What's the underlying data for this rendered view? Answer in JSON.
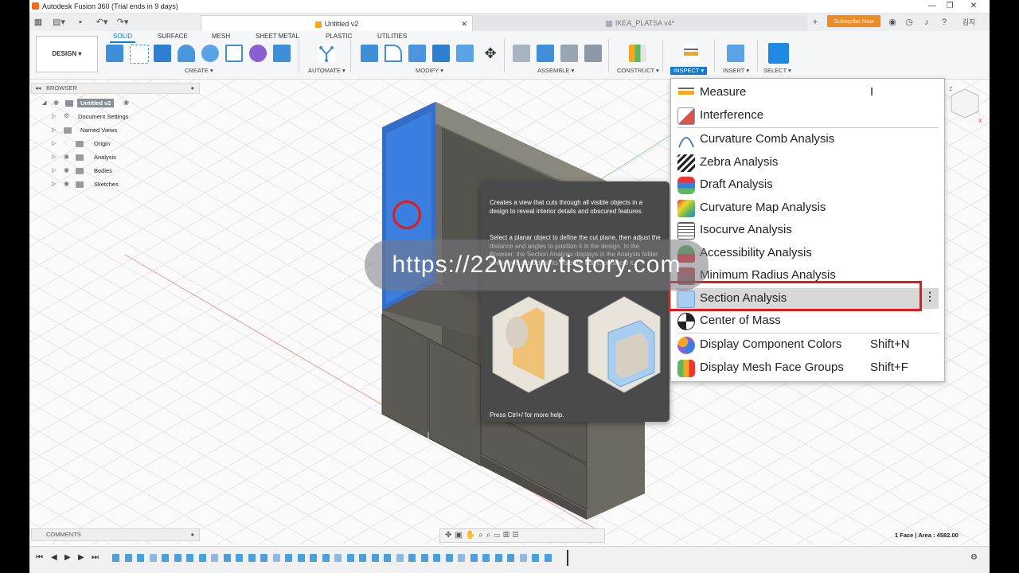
{
  "window": {
    "title": "Autodesk Fusion 360 (Trial ends in 9 days)"
  },
  "tabs": [
    {
      "label": "Untitled v2"
    },
    {
      "label": "IKEA_PLATSA v4*"
    }
  ],
  "header": {
    "subscribe_label": "Subscribe Now",
    "user_label": "김지"
  },
  "toolbar": {
    "workspace_label": "DESIGN ▾",
    "ws_tabs": [
      "SOLID",
      "SURFACE",
      "MESH",
      "SHEET METAL",
      "PLASTIC",
      "UTILITIES"
    ],
    "groups": [
      "CREATE ▾",
      "AUTOMATE ▾",
      "MODIFY ▾",
      "ASSEMBLE ▾",
      "CONSTRUCT ▾",
      "INSPECT ▾",
      "INSERT ▾",
      "SELECT ▾"
    ]
  },
  "browser": {
    "title": "BROWSER",
    "root": "Untitled v2",
    "items": [
      "Document Settings",
      "Named Views",
      "Origin",
      "Analysis",
      "Bodies",
      "Sketches"
    ]
  },
  "comments_label": "COMMENTS",
  "status_text": "1 Face | Area : 4582.00",
  "inspect_menu": {
    "items": [
      {
        "label": "Measure",
        "shortcut": "I"
      },
      {
        "label": "Interference",
        "shortcut": ""
      },
      {
        "label": "Curvature Comb Analysis",
        "shortcut": ""
      },
      {
        "label": "Zebra Analysis",
        "shortcut": ""
      },
      {
        "label": "Draft Analysis",
        "shortcut": ""
      },
      {
        "label": "Curvature Map Analysis",
        "shortcut": ""
      },
      {
        "label": "Isocurve Analysis",
        "shortcut": ""
      },
      {
        "label": "Accessibility Analysis",
        "shortcut": ""
      },
      {
        "label": "Minimum Radius Analysis",
        "shortcut": ""
      },
      {
        "label": "Section Analysis",
        "shortcut": ""
      },
      {
        "label": "Center of Mass",
        "shortcut": ""
      },
      {
        "label": "Display Component Colors",
        "shortcut": "Shift+N"
      },
      {
        "label": "Display Mesh Face Groups",
        "shortcut": "Shift+F"
      }
    ]
  },
  "tooltip": {
    "p1": "Creates a view that cuts through all visible objects in a design to reveal interior details and obscured features.",
    "p2": "Select a planar object to define the cut plane, then adjust the distance and angles to position it in the design. In the Browser, the Section Analysis displays in the Analysis folder where you can adjust its visibility, edit it, or delete it.",
    "help": "Press Ctrl+/ for more help."
  },
  "watermark": "https://22www.tistory.com",
  "colors": {
    "accent": "#0b7bd4",
    "highlight_red": "#e21a1a",
    "subscribe": "#f08a24"
  }
}
